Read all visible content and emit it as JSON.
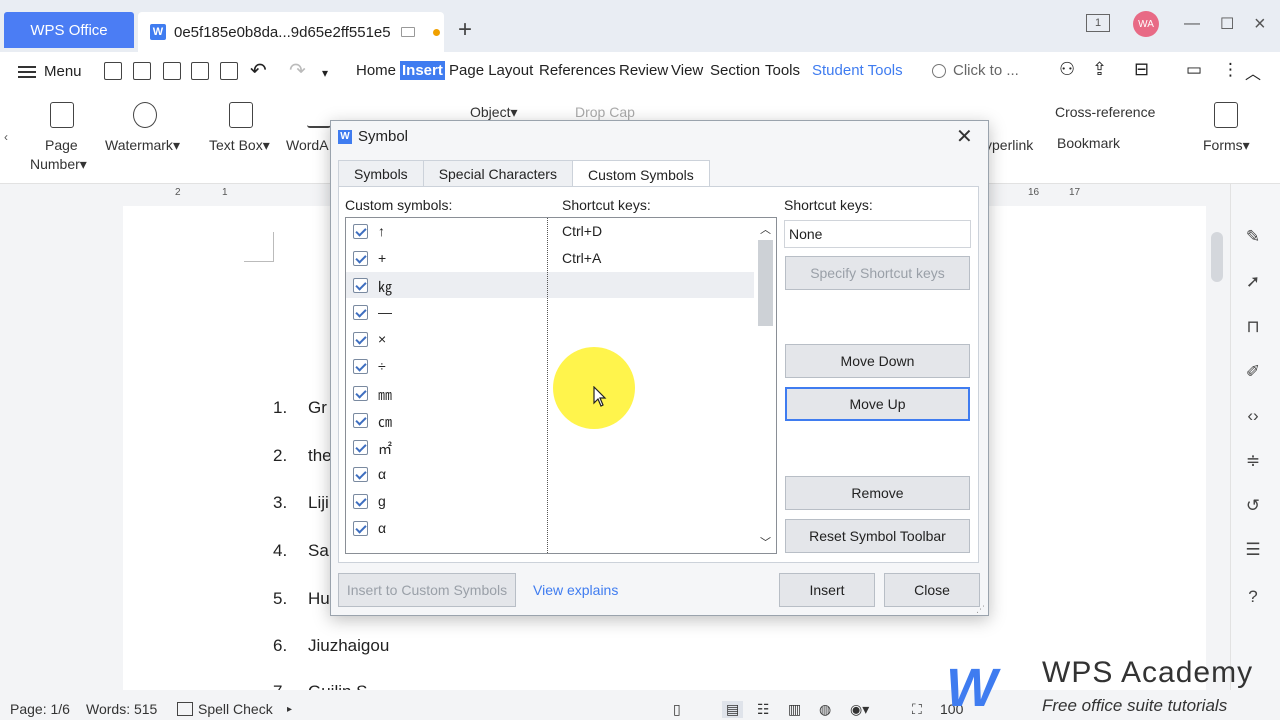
{
  "titlebar": {
    "app_tab": "WPS Office",
    "doc_tab": "0e5f185e0b8da...9d65e2ff551e5",
    "avatar": "WA"
  },
  "menubar": {
    "menu_label": "Menu",
    "items": [
      "Home",
      "Insert",
      "Page Layout",
      "References",
      "Review",
      "View",
      "Section",
      "Tools",
      "Student Tools"
    ],
    "search_placeholder": "Click to ..."
  },
  "ribbon": {
    "page_number": "Page",
    "page_number2": "Number",
    "watermark": "Watermark",
    "text_box": "Text Box",
    "wordart": "WordA",
    "object": "Object",
    "drop_cap": "Drop Cap",
    "hyperlink": "yperlink",
    "cross_reference": "Cross-reference",
    "bookmark": "Bookmark",
    "forms": "Forms"
  },
  "ruler": {
    "nums": [
      "2",
      "1",
      "1",
      "16",
      "17"
    ]
  },
  "document": {
    "list": [
      {
        "num": "1.",
        "text": "Gr"
      },
      {
        "num": "2.",
        "text": "the"
      },
      {
        "num": "3.",
        "text": "Liji"
      },
      {
        "num": "4.",
        "text": "Sa"
      },
      {
        "num": "5.",
        "text": "Hu"
      },
      {
        "num": "6.",
        "text": "Jiuzhaigou"
      },
      {
        "num": "7.",
        "text": "Guilin S"
      }
    ]
  },
  "dialog": {
    "title": "Symbol",
    "tabs": [
      "Symbols",
      "Special Characters",
      "Custom Symbols"
    ],
    "col_symbols": "Custom symbols:",
    "col_keys": "Shortcut keys:",
    "shortcut_label": "Shortcut keys:",
    "shortcut_value": "None",
    "rows": [
      {
        "sym": "↑",
        "key": "Ctrl+D"
      },
      {
        "sym": "+",
        "key": "Ctrl+A"
      },
      {
        "sym": "㎏",
        "key": ""
      },
      {
        "sym": "—",
        "key": ""
      },
      {
        "sym": "×",
        "key": ""
      },
      {
        "sym": "÷",
        "key": ""
      },
      {
        "sym": "㎜",
        "key": ""
      },
      {
        "sym": "㎝",
        "key": ""
      },
      {
        "sym": "㎡",
        "key": ""
      },
      {
        "sym": "α",
        "key": ""
      },
      {
        "sym": "g",
        "key": ""
      },
      {
        "sym": "α",
        "key": ""
      }
    ],
    "buttons": {
      "specify": "Specify Shortcut keys",
      "move_down": "Move Down",
      "move_up": "Move Up",
      "remove": "Remove",
      "reset": "Reset Symbol Toolbar",
      "insert_custom": "Insert to Custom Symbols",
      "view_explains": "View explains",
      "insert": "Insert",
      "close": "Close"
    }
  },
  "statusbar": {
    "page": "Page: 1/6",
    "words": "Words: 515",
    "spell": "Spell Check",
    "zoom": "100"
  },
  "watermark": {
    "title": "WPS Academy",
    "subtitle": "Free office suite tutorials"
  },
  "colors": {
    "accent": "#3f7cf0",
    "highlight": "#fff000"
  }
}
